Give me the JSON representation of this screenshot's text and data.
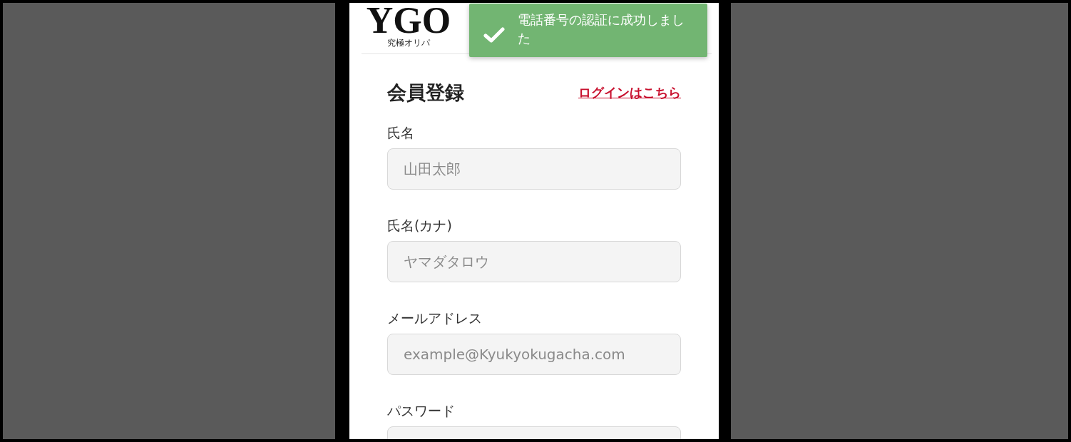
{
  "header": {
    "logo": "YGO",
    "logo_subtitle": "究極オリパ"
  },
  "toast": {
    "kind": "success",
    "message": "電話番号の認証に成功しました"
  },
  "form": {
    "title": "会員登録",
    "login_link": "ログインはこちら",
    "fields": [
      {
        "label": "氏名",
        "placeholder": "山田太郎"
      },
      {
        "label": "氏名(カナ)",
        "placeholder": "ヤマダタロウ"
      },
      {
        "label": "メールアドレス",
        "placeholder": "example@Kyukyokugacha.com"
      },
      {
        "label": "パスワード"
      }
    ]
  }
}
